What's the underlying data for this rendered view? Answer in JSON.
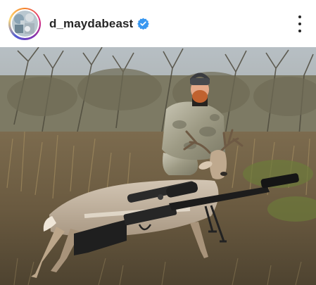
{
  "post": {
    "username": "d_maydabeast",
    "verified": true,
    "accent_color": "#3897f0",
    "avatar_icon": "profile-avatar",
    "menu_icon": "more-options-icon",
    "media": {
      "kind": "photo"
    }
  }
}
